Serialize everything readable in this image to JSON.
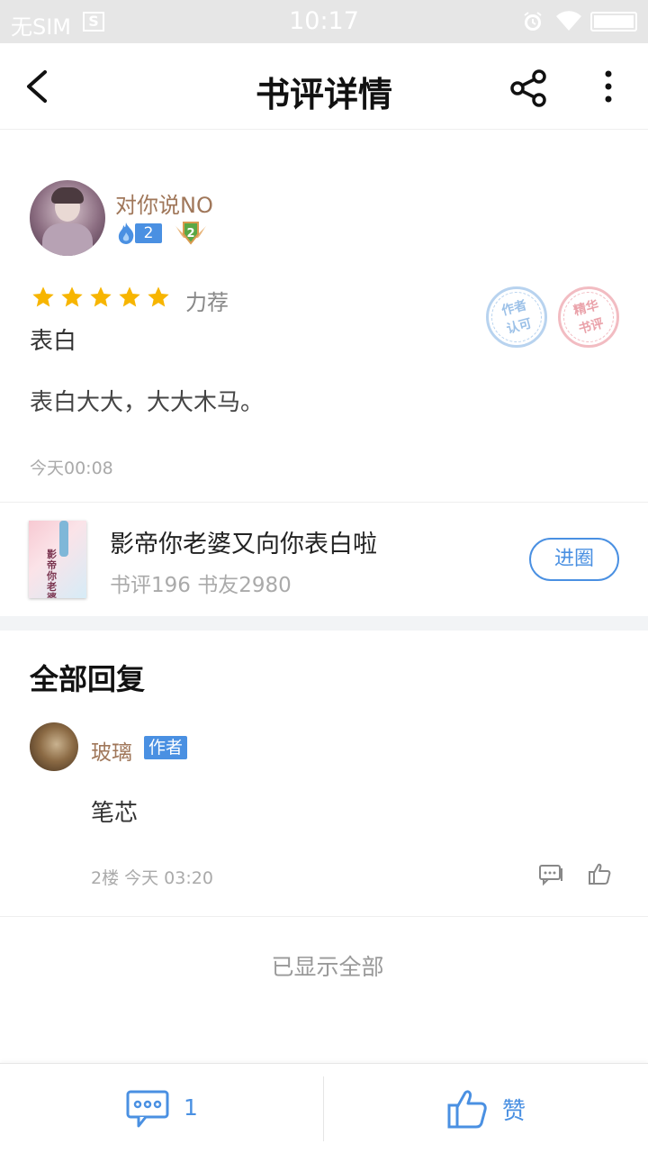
{
  "status_bar": {
    "carrier": "无SIM",
    "sim_icon_glyph": "S",
    "time": "10:17",
    "icons": [
      "sim-icon",
      "alarm-icon",
      "wifi-icon",
      "battery-icon"
    ]
  },
  "header": {
    "title": "书评详情",
    "icons": [
      "back-icon",
      "share-icon",
      "more-icon"
    ]
  },
  "review": {
    "user": {
      "name": "对你说NO",
      "level": "2",
      "medal_level": "2"
    },
    "rating_stars": 5,
    "rating_label": "力荐",
    "title": "表白",
    "body": "表白大大，大大木马。",
    "time": "今天00:08",
    "stamps": {
      "author_line1": "作者",
      "author_line2": "认可",
      "best_line1": "精华",
      "best_line2": "书评"
    }
  },
  "book": {
    "title": "影帝你老婆又向你表白啦",
    "stats": "书评196 书友2980",
    "join_label": "进圈",
    "cover_text": "影帝你老婆"
  },
  "replies": {
    "heading": "全部回复",
    "items": [
      {
        "user": "玻璃",
        "tag": "作者",
        "body": "笔芯",
        "meta": "2楼 今天 03:20"
      }
    ],
    "end_text": "已显示全部"
  },
  "bottom_bar": {
    "comment_count": "1",
    "like_label": "赞"
  },
  "colors": {
    "accent": "#4a90e2",
    "username": "#a0775a",
    "star": "#f7b500",
    "status_bar_bg": "#e6e6e6"
  }
}
